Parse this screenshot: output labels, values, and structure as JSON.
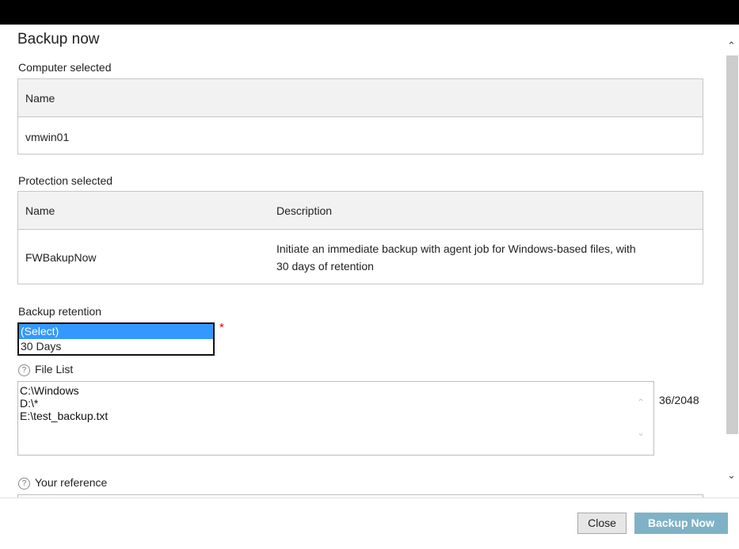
{
  "dialog": {
    "title": "Backup now"
  },
  "computer_selected": {
    "label": "Computer selected",
    "header": "Name",
    "rows": [
      {
        "name": "vmwin01"
      }
    ]
  },
  "protection_selected": {
    "label": "Protection selected",
    "headers": {
      "name": "Name",
      "description": "Description"
    },
    "rows": [
      {
        "name": "FWBakupNow",
        "description_line1": "Initiate an immediate backup with agent job for Windows-based files, with",
        "description_line2": "30 days of retention"
      }
    ]
  },
  "backup_retention": {
    "label": "Backup retention",
    "options": [
      "(Select)",
      "30 Days"
    ],
    "selected": "(Select)",
    "required_mark": "*"
  },
  "file_list": {
    "label": "File List",
    "help": "?",
    "lines": [
      "C:\\Windows",
      "D:\\*",
      "E:\\test_backup.txt"
    ],
    "counter": "36/2048"
  },
  "your_reference": {
    "label": "Your reference",
    "help": "?",
    "value": ""
  },
  "footer": {
    "close_label": "Close",
    "backup_label": "Backup Now"
  },
  "icons": {
    "scroll_up": "chevron-up-icon",
    "scroll_down": "chevron-down-icon",
    "help": "question-circle-icon"
  },
  "colors": {
    "primary_button": "#7fb2c7",
    "selection": "#3399ff",
    "required": "#e00000"
  }
}
